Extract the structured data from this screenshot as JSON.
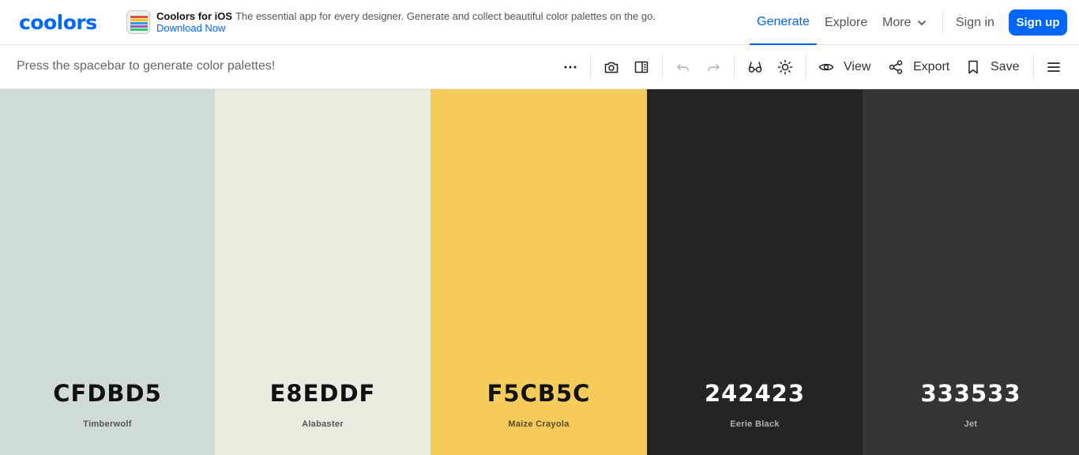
{
  "header": {
    "logo": "coolors",
    "promo": {
      "title": "Coolors for iOS",
      "description": "The essential app for every designer. Generate and collect beautiful color palettes on the go.",
      "link": "Download Now"
    },
    "nav": {
      "generate": "Generate",
      "explore": "Explore",
      "more": "More",
      "signin": "Sign in",
      "signup": "Sign up"
    }
  },
  "toolbar": {
    "hint": "Press the spacebar to generate color palettes!",
    "view_label": "View",
    "export_label": "Export",
    "save_label": "Save",
    "icons": [
      "more-dots-icon",
      "camera-icon",
      "side-panel-icon",
      "undo-icon",
      "redo-icon",
      "glasses-icon",
      "sun-icon",
      "eye-icon",
      "share-icon",
      "bookmark-icon",
      "menu-icon"
    ]
  },
  "colors": {
    "brand": "#0066ff"
  },
  "palette": [
    {
      "hex": "CFDBD5",
      "name": "Timberwolf",
      "bg": "#CFDBD5",
      "text": "#111111",
      "subtext": "#555555"
    },
    {
      "hex": "E8EDDF",
      "name": "Alabaster",
      "bg": "#E8EDDF",
      "text": "#111111",
      "subtext": "#555555"
    },
    {
      "hex": "F5CB5C",
      "name": "Maize Crayola",
      "bg": "#F5CB5C",
      "text": "#111111",
      "subtext": "#5a4a20"
    },
    {
      "hex": "242423",
      "name": "Eerie Black",
      "bg": "#242423",
      "text": "#ffffff",
      "subtext": "#b0b0b0"
    },
    {
      "hex": "333533",
      "name": "Jet",
      "bg": "#333533",
      "text": "#ffffff",
      "subtext": "#b0b0b0"
    }
  ]
}
